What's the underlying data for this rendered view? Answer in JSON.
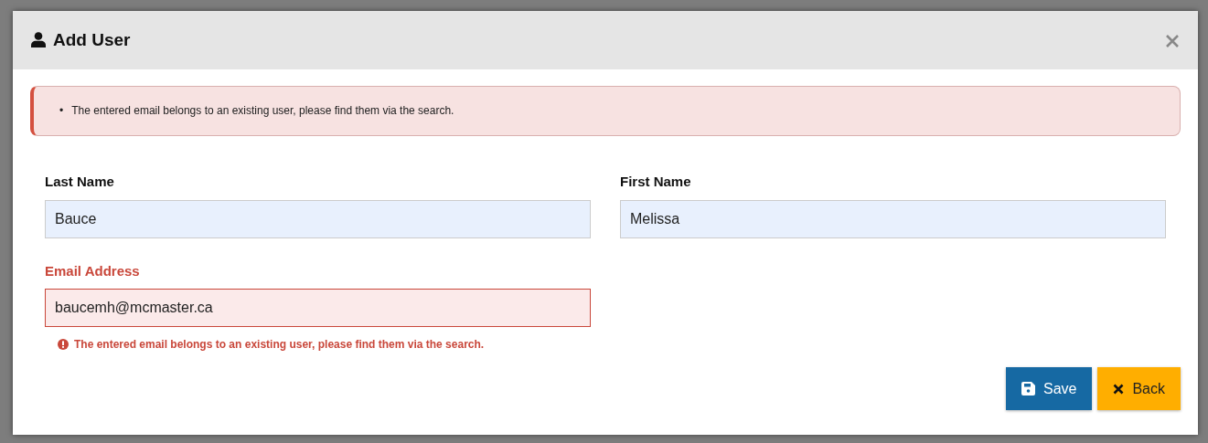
{
  "dialog": {
    "title": "Add User"
  },
  "alert": {
    "messages": [
      {
        "bullet": "•",
        "text": "The entered email belongs to an existing user, please find them via the search."
      }
    ]
  },
  "fields": [
    {
      "label": "Last Name",
      "value": "Bauce",
      "invalid": false
    },
    {
      "label": "First Name",
      "value": "Melissa",
      "invalid": false
    },
    {
      "label": "Email Address",
      "value": "baucemh@mcmaster.ca",
      "invalid": true,
      "error": "The entered email belongs to an existing user, please find them via the search."
    }
  ],
  "buttons": [
    {
      "label": "Save",
      "kind": "save"
    },
    {
      "label": "Back",
      "kind": "back"
    }
  ]
}
